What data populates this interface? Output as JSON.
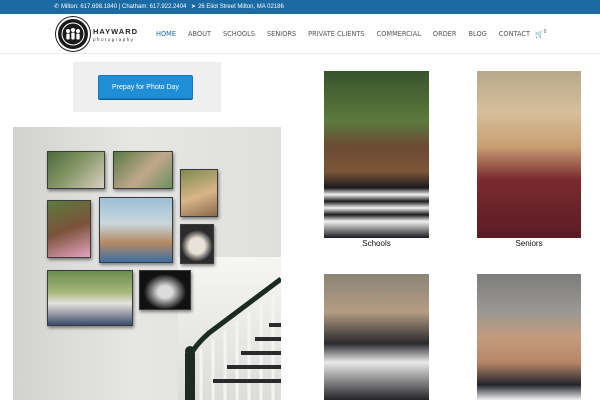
{
  "topbar": {
    "milton": "Milton: 617.698.1840",
    "sep": " | ",
    "chatham": "Chatham: 617.922.2404",
    "address": "26 Eliot Street Milton, MA 02186"
  },
  "brand": {
    "name": "HAYWARD",
    "sub": "photography"
  },
  "nav": [
    "HOME",
    "ABOUT",
    "SCHOOLS",
    "SENIORS",
    "PRIVATE CLIENTS",
    "COMMERCIAL",
    "ORDER",
    "BLOG",
    "CONTACT"
  ],
  "cart": {
    "icon": "shopping-cart-icon",
    "count": "0"
  },
  "prepay": {
    "button_label": "Prepay for Photo Day"
  },
  "tiles": {
    "schools": "Schools",
    "seniors": "Seniors"
  },
  "colors": {
    "accent": "#1c6aa3",
    "button": "#1e8fd6"
  }
}
